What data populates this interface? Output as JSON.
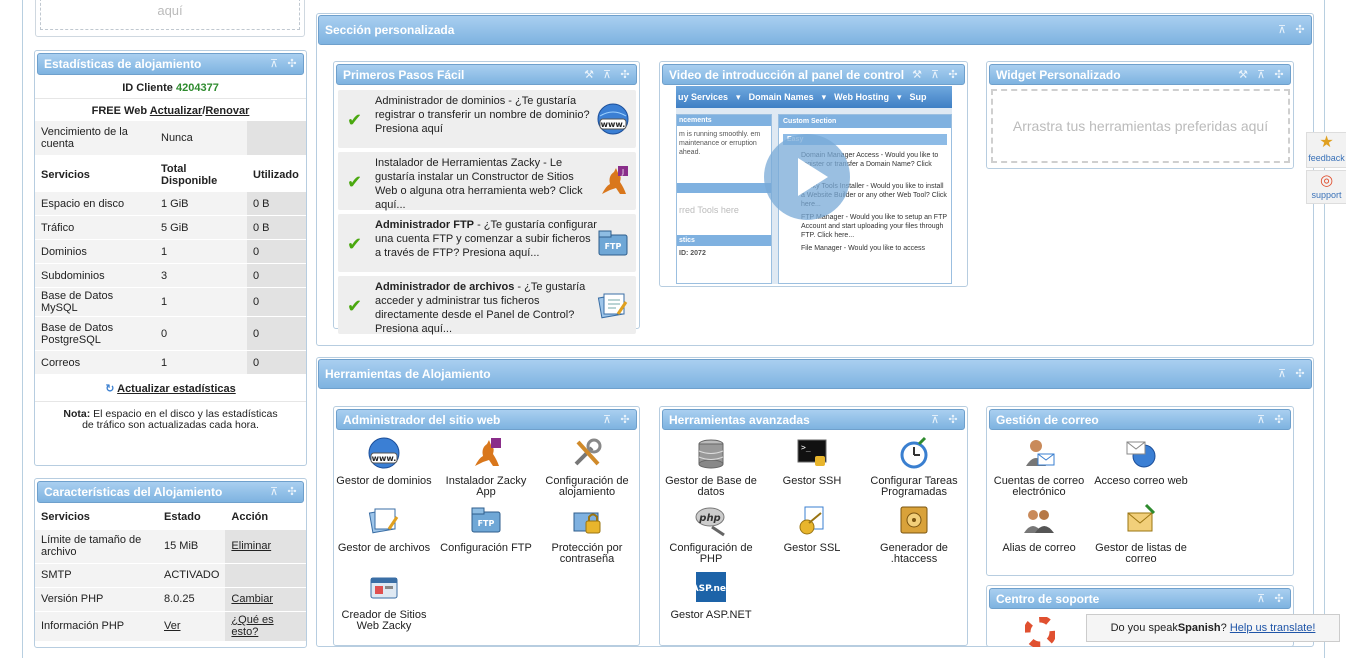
{
  "left_top": {
    "placeholder": "aquí"
  },
  "stats": {
    "title": "Estadísticas de alojamiento",
    "client_label": "ID Cliente",
    "client_id": "4204377",
    "plan_label": "FREE Web",
    "update_link": "Actualizar",
    "sep": "/",
    "renew_link": "Renovar",
    "expiry_label": "Vencimiento de la cuenta",
    "expiry_value": "Nunca",
    "headers": [
      "Servicios",
      "Total Disponible",
      "Utilizado"
    ],
    "rows": [
      [
        "Espacio en disco",
        "1 GiB",
        "0 B"
      ],
      [
        "Tráfico",
        "5 GiB",
        "0 B"
      ],
      [
        "Dominios",
        "1",
        "0"
      ],
      [
        "Subdominios",
        "3",
        "0"
      ],
      [
        "Base de Datos MySQL",
        "1",
        "0"
      ],
      [
        "Base de Datos PostgreSQL",
        "0",
        "0"
      ],
      [
        "Correos",
        "1",
        "0"
      ]
    ],
    "refresh_link": "Actualizar estadísticas",
    "note_label": "Nota:",
    "note_text": "El espacio en el disco y las estadísticas de tráfico son actualizadas cada hora."
  },
  "features": {
    "title": "Características del Alojamiento",
    "headers": [
      "Servicios",
      "Estado",
      "Acción"
    ],
    "rows": [
      [
        "Límite de tamaño de archivo",
        "15 MiB",
        "Eliminar"
      ],
      [
        "SMTP",
        "ACTIVADO",
        ""
      ],
      [
        "Versión PHP",
        "8.0.25",
        "Cambiar"
      ],
      [
        "Información PHP",
        "Ver",
        "¿Qué es esto?"
      ]
    ]
  },
  "custom_section": {
    "title": "Sección personalizada",
    "first_steps": {
      "title": "Primeros Pasos Fácil",
      "items": [
        {
          "bold": "",
          "text": "Administrador de dominios - ¿Te gustaría registrar o transferir un nombre de dominio? Presiona aquí",
          "icon": "www-globe-icon"
        },
        {
          "bold": "",
          "text": "Instalador de Herramientas Zacky - Le gustaría instalar un Constructor de Sitios Web o alguna otra herramienta web? Click aquí...",
          "icon": "kangaroo-icon"
        },
        {
          "bold": "Administrador FTP",
          "text": " - ¿Te gustaría configurar una cuenta FTP y comenzar a subir ficheros a través de FTP? Presiona aquí...",
          "icon": "ftp-folder-icon"
        },
        {
          "bold": "Administrador de archivos",
          "text": " - ¿Te gustaría acceder y administrar tus ficheros directamente desde el Panel de Control? Presiona aquí...",
          "icon": "file-manager-icon"
        }
      ]
    },
    "video": {
      "title": "Video de introducción al panel de control",
      "menu": [
        "uy Services",
        "Domain Names",
        "Web Hosting",
        "Sup"
      ],
      "left_heading": "ncements",
      "left_text": "m is running smoothly. em maintenance or erruption ahead.",
      "left_tools": "rred Tools here",
      "left_stats": "stics",
      "left_id": "ID: 2072",
      "custom_section": "Custom Section",
      "easy": "Easy",
      "items": [
        "Domain Manager Access - Would you like to register or transfer a Domain Name? Click here",
        "Zacky Tools Installer - Would you like to install a Website Builder or any other Web Tool? Click here...",
        "FTP Manager - Would you like to setup an FTP Account and start uploading your files through FTP. Click here...",
        "File Manager - Would you like to access"
      ]
    },
    "widget": {
      "title": "Widget Personalizado",
      "placeholder": "Arrastra tus herramientas preferidas aquí"
    }
  },
  "hosting_tools": {
    "title": "Herramientas de Alojamiento",
    "site_admin": {
      "title": "Administrador del sitio web",
      "tools": [
        {
          "label": "Gestor de dominios",
          "icon": "www-globe-icon"
        },
        {
          "label": "Instalador Zacky App",
          "icon": "kangaroo-icon"
        },
        {
          "label": "Configuración de alojamiento",
          "icon": "tools-icon"
        },
        {
          "label": "Gestor de archivos",
          "icon": "file-manager-icon"
        },
        {
          "label": "Configuración FTP",
          "icon": "ftp-folder-icon"
        },
        {
          "label": "Protección por contraseña",
          "icon": "lock-folder-icon"
        },
        {
          "label": "Creador de Sitios Web Zacky",
          "icon": "site-builder-icon"
        }
      ]
    },
    "advanced": {
      "title": "Herramientas avanzadas",
      "tools": [
        {
          "label": "Gestor de Base de datos",
          "icon": "database-icon"
        },
        {
          "label": "Gestor SSH",
          "icon": "terminal-icon"
        },
        {
          "label": "Configurar Tareas Programadas",
          "icon": "scheduled-tasks-icon"
        },
        {
          "label": "Configuración de PHP",
          "icon": "php-icon"
        },
        {
          "label": "Gestor SSL",
          "icon": "ssl-icon"
        },
        {
          "label": "Generador de .htaccess",
          "icon": "safe-icon"
        },
        {
          "label": "Gestor ASP.NET",
          "icon": "aspnet-icon"
        }
      ]
    },
    "mail": {
      "title": "Gestión de correo",
      "tools": [
        {
          "label": "Cuentas de correo electrónico",
          "icon": "email-account-icon"
        },
        {
          "label": "Acceso correo web",
          "icon": "webmail-icon"
        },
        {
          "label": "Alias de correo",
          "icon": "mail-alias-icon"
        },
        {
          "label": "Gestor de listas de correo",
          "icon": "mailing-list-icon"
        }
      ]
    },
    "support": {
      "title": "Centro de soporte"
    }
  },
  "side": {
    "feedback": "feedback",
    "support": "support"
  },
  "translate_bar": {
    "prefix": "Do you speak ",
    "language": "Spanish",
    "suffix": "? ",
    "link": "Help us translate!"
  },
  "controls": {
    "pin": "⊼",
    "move": "✣",
    "wrench": "🔧"
  }
}
